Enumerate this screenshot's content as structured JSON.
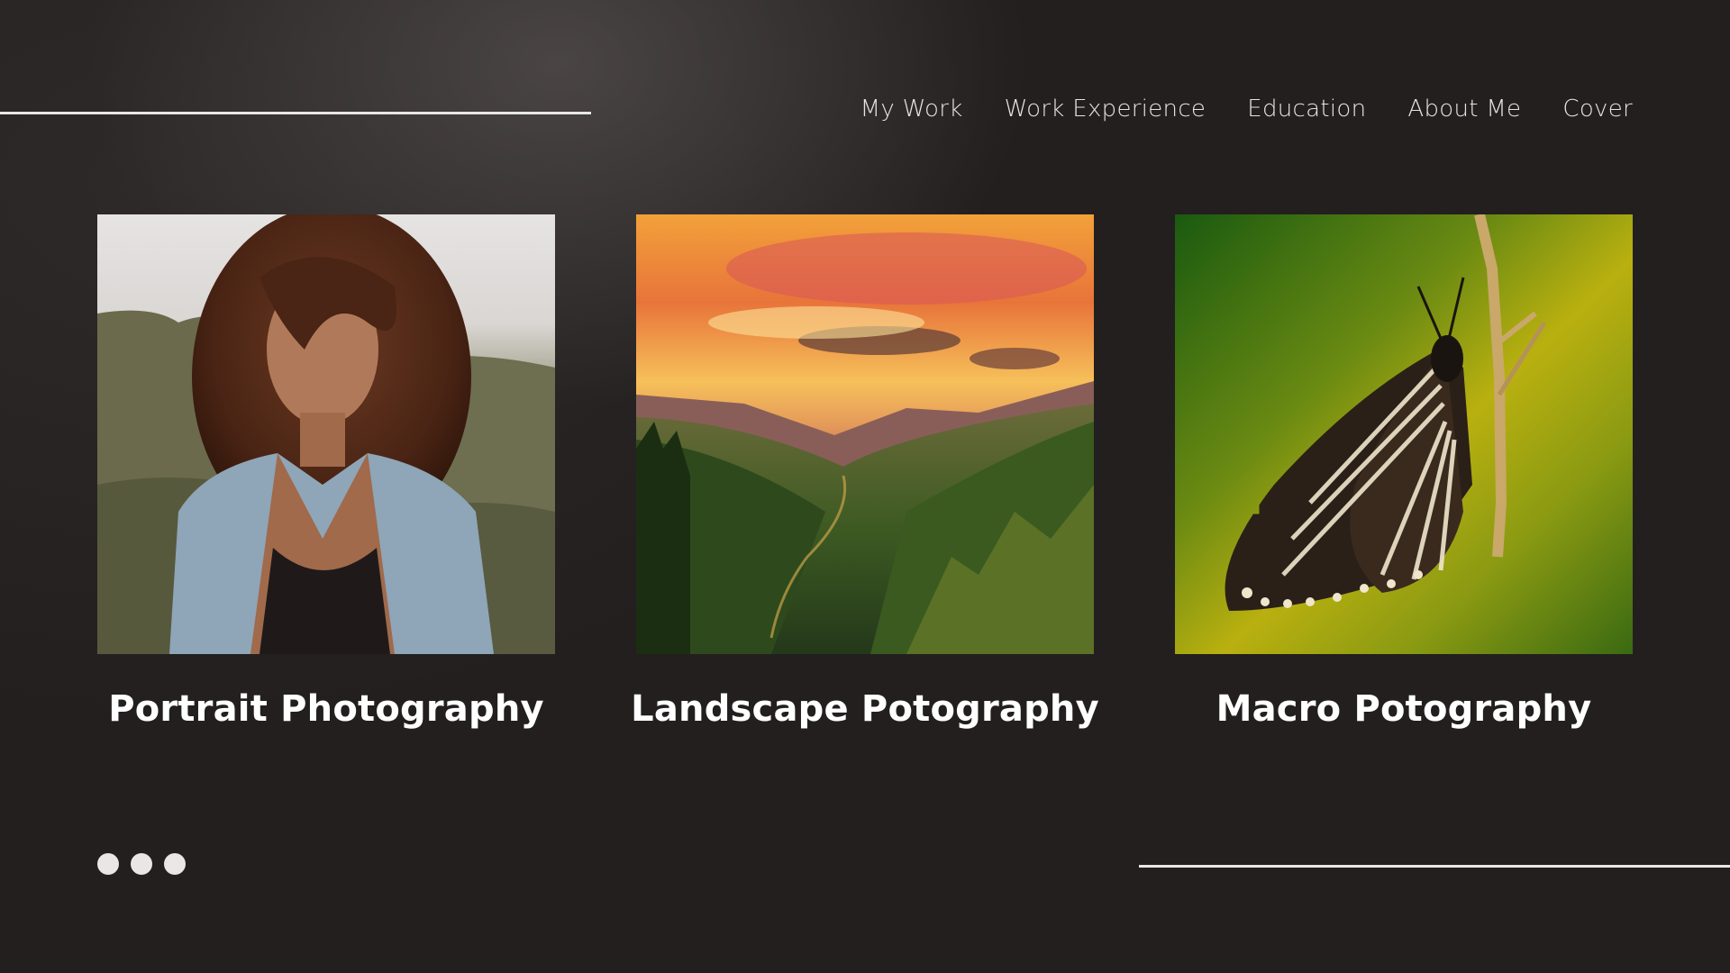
{
  "nav": {
    "items": [
      {
        "label": "My Work"
      },
      {
        "label": "Work Experience"
      },
      {
        "label": "Education"
      },
      {
        "label": "About Me"
      },
      {
        "label": "Cover"
      }
    ]
  },
  "cards": [
    {
      "caption": "Portrait Photography",
      "image": "portrait-photo"
    },
    {
      "caption": "Landscape Potography",
      "image": "landscape-photo"
    },
    {
      "caption": "Macro Potography",
      "image": "butterfly-macro-photo"
    }
  ],
  "colors": {
    "background": "#231f1f",
    "text": "#ffffff",
    "accent_line": "#e9e6e3"
  },
  "icons": [
    "more-dots-icon"
  ]
}
